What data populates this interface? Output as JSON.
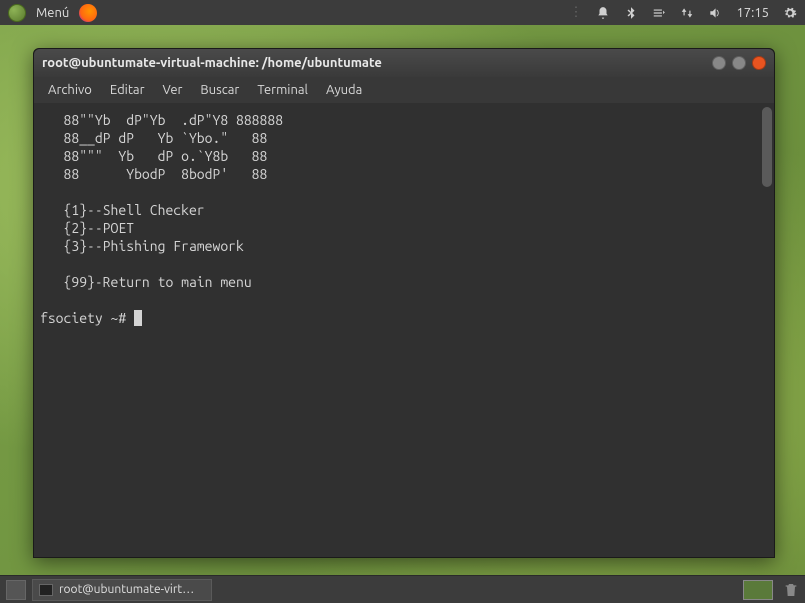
{
  "top_panel": {
    "menu_label": "Menú",
    "time": "17:15"
  },
  "terminal": {
    "title": "root@ubuntumate-virtual-machine: /home/ubuntumate",
    "menu": {
      "archivo": "Archivo",
      "editar": "Editar",
      "ver": "Ver",
      "buscar": "Buscar",
      "terminal": "Terminal",
      "ayuda": "Ayuda"
    },
    "ascii_art": "   88\"\"Yb  dP\"Yb  .dP\"Y8 888888\n   88__dP dP   Yb `Ybo.\"   88\n   88\"\"\"  Yb   dP o.`Y8b   88\n   88      YbodP  8bodP'   88",
    "options": [
      "   {1}--Shell Checker",
      "   {2}--POET",
      "   {3}--Phishing Framework"
    ],
    "return_option": "   {99}-Return to main menu",
    "prompt": "fsociety ~# "
  },
  "bottom_panel": {
    "task_label": "root@ubuntumate-virt…"
  }
}
